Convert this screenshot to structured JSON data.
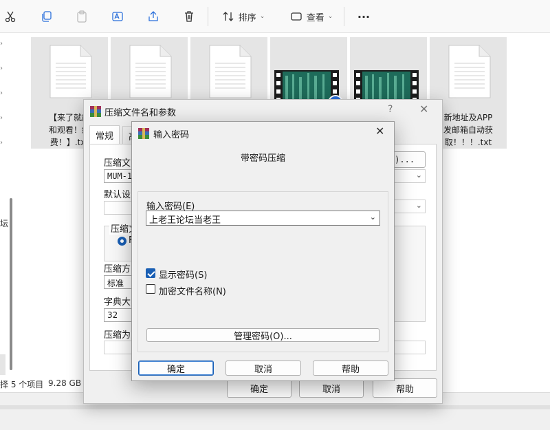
{
  "toolbar": {
    "sort_label": "排序",
    "view_label": "查看",
    "more_label": "···"
  },
  "leftnav": {
    "partial_item": "坛"
  },
  "files": [
    {
      "type": "doc",
      "lines": [
        "【来了就能",
        "和观看！终",
        "费！】.txt"
      ]
    },
    {
      "type": "doc",
      "lines": [
        "",
        "",
        ""
      ]
    },
    {
      "type": "doc",
      "lines": [
        "",
        "",
        ""
      ]
    },
    {
      "type": "video",
      "lines": [
        "",
        "",
        ""
      ]
    },
    {
      "type": "video",
      "lines": [
        "",
        "",
        ""
      ]
    },
    {
      "type": "doc",
      "lines": [
        "新地址及APP",
        "发邮箱自动获",
        "取！！！.txt"
      ]
    }
  ],
  "status": {
    "selection": "择 5 个项目",
    "size": "9.28 GB"
  },
  "archive_dialog": {
    "title": "压缩文件名和参数",
    "help_q": "?",
    "close": "✕",
    "tab_general": "常规",
    "tab_advanced": "高",
    "archive_name_label": "压缩文",
    "archive_name_value": "MUM-12",
    "browse_label": "B)...",
    "default_profile_label": "默认设",
    "format_group_label": "压缩文",
    "format_radio_label": "R",
    "method_label": "压缩方",
    "method_value": "标准",
    "dict_label": "字典大",
    "dict_value": "32",
    "split_label": "压缩为",
    "ok": "确定",
    "cancel": "取消",
    "help": "帮助"
  },
  "password_dialog": {
    "title": "输入密码",
    "close": "✕",
    "heading": "带密码压缩",
    "password_label": "输入密码(E)",
    "password_value": "上老王论坛当老王",
    "show_password_label": "显示密码(S)",
    "show_password_checked": true,
    "encrypt_names_label": "加密文件名称(N)",
    "encrypt_names_checked": false,
    "manage_label": "管理密码(O)...",
    "ok": "确定",
    "cancel": "取消",
    "help": "帮助"
  },
  "colors": {
    "accent": "#1a5fb4",
    "tile_bg": "#e5e5e5",
    "dialog_bg": "#f0f0f0"
  }
}
